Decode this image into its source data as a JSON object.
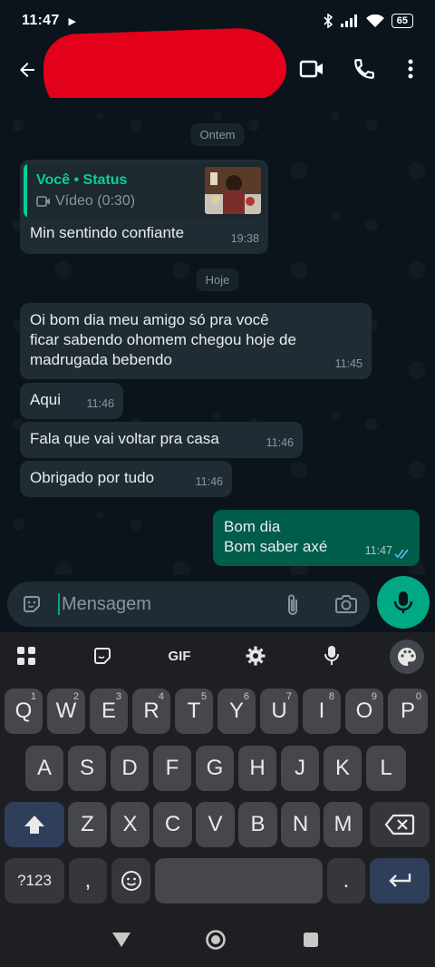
{
  "status_bar": {
    "time": "11:47",
    "battery": "65",
    "icons": [
      "play-icon",
      "bluetooth-icon",
      "signal-icon",
      "wifi-icon",
      "battery-icon"
    ]
  },
  "app_bar": {
    "contact_name": "",
    "actions": [
      "video-call-icon",
      "voice-call-icon",
      "more-vert-icon"
    ]
  },
  "chat": {
    "dates": {
      "yesterday": "Ontem",
      "today": "Hoje"
    },
    "status_reply": {
      "quote_title": "Você • Status",
      "quote_sub": "Vídeo (0:30)",
      "text": "Min sentindo confiante",
      "time": "19:38"
    },
    "incoming": [
      {
        "lines": [
          "Oi bom dia meu amigo só pra você",
          "ficar sabendo ohomem chegou hoje de",
          "madrugada bebendo"
        ],
        "time": "11:45"
      },
      {
        "lines": [
          "Aqui"
        ],
        "time": "11:46"
      },
      {
        "lines": [
          "Fala que vai voltar pra casa"
        ],
        "time": "11:46"
      },
      {
        "lines": [
          "Obrigado por tudo"
        ],
        "time": "11:46"
      }
    ],
    "outgoing": {
      "lines": [
        "Bom dia",
        "Bom saber axé"
      ],
      "time": "11:47",
      "status": "read"
    }
  },
  "composer": {
    "placeholder": "Mensagem"
  },
  "keyboard": {
    "toolbar": {
      "gif_label": "GIF"
    },
    "row1": [
      "Q",
      "W",
      "E",
      "R",
      "T",
      "Y",
      "U",
      "I",
      "O",
      "P"
    ],
    "row1_hints": [
      "1",
      "2",
      "3",
      "4",
      "5",
      "6",
      "7",
      "8",
      "9",
      "0"
    ],
    "row2": [
      "A",
      "S",
      "D",
      "F",
      "G",
      "H",
      "J",
      "K",
      "L"
    ],
    "row3": [
      "Z",
      "X",
      "C",
      "V",
      "B",
      "N",
      "M"
    ],
    "symbols_label": "?123",
    "comma": ",",
    "period": "."
  },
  "colors": {
    "background": "#0b141a",
    "incoming_bubble": "#202c33",
    "outgoing_bubble": "#005c4b",
    "accent": "#00a884",
    "quote_accent": "#06cf9c",
    "read_ticks": "#53bdeb"
  }
}
